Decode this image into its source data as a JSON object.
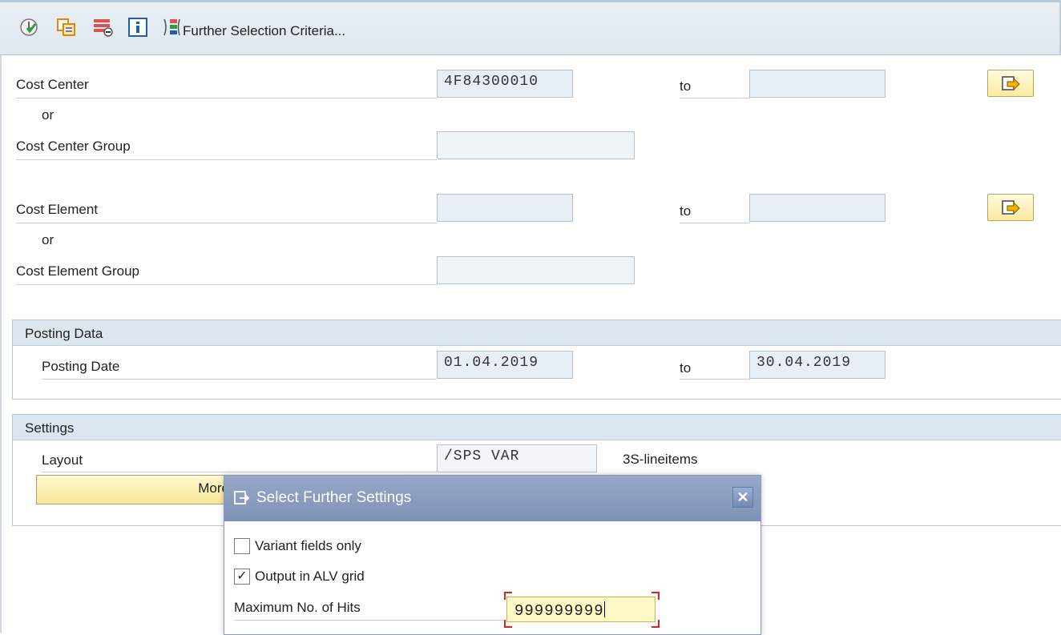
{
  "toolbar": {
    "icons": [
      "execute-icon",
      "copy-icon",
      "delete-row-icon",
      "info-icon",
      "selection-criteria-icon"
    ],
    "further_selection_label": "Further Selection Criteria..."
  },
  "cost_center": {
    "label": "Cost Center",
    "from_value": "4F84300010",
    "to_label": "to",
    "to_value": ""
  },
  "or_label_1": "or",
  "cost_center_group": {
    "label": "Cost Center Group",
    "value": ""
  },
  "cost_element": {
    "label": "Cost Element",
    "from_value": "",
    "to_label": "to",
    "to_value": ""
  },
  "or_label_2": "or",
  "cost_element_group": {
    "label": "Cost Element Group",
    "value": ""
  },
  "posting_data": {
    "title": "Posting Data",
    "posting_date_label": "Posting Date",
    "from_value": "01.04.2019",
    "to_label": "to",
    "to_value": "30.04.2019"
  },
  "settings": {
    "title": "Settings",
    "layout_label": "Layout",
    "layout_value": "/SPS VAR",
    "layout_description": "3S-lineitems",
    "more_settings_label": "More Setti"
  },
  "dialog": {
    "title": "Select Further Settings",
    "variant_fields_label": "Variant fields only",
    "variant_fields_checked": false,
    "alv_grid_label": "Output in ALV grid",
    "alv_grid_checked": true,
    "alv_check_mark": "✓",
    "max_hits_label": "Maximum No. of Hits",
    "max_hits_value": "999999999"
  },
  "colors": {
    "toolbar_bg": "#e4ebf2",
    "field_bg": "#e7eef5",
    "yellow_button": "#f8e69a",
    "dialog_title_bg": "#8798bb",
    "focus_red": "#e02020"
  }
}
